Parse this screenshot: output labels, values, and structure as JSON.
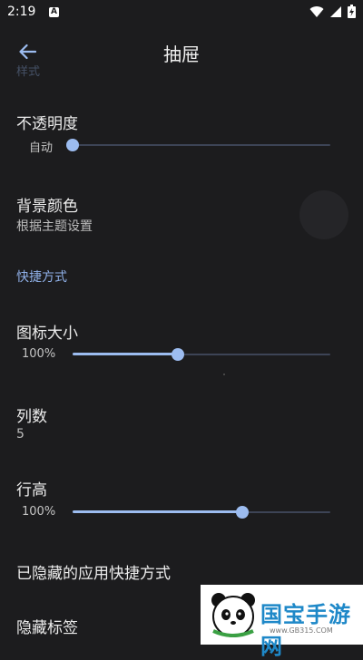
{
  "status_bar": {
    "time": "2:19",
    "notification_glyph": "A",
    "icons": [
      "wifi-icon",
      "signal-icon",
      "battery-icon"
    ]
  },
  "appbar": {
    "title": "抽屉",
    "back_icon": "arrow-left-icon",
    "ghost_label": "样式"
  },
  "settings": {
    "opacity": {
      "title": "不透明度",
      "value_label": "自动",
      "value": 0.0
    },
    "background_color": {
      "title": "背景颜色",
      "subtitle": "根据主题设置"
    },
    "shortcuts_section": "快捷方式",
    "icon_size": {
      "title": "图标大小",
      "value_label": "100%",
      "value": 0.41
    },
    "columns": {
      "title": "列数",
      "subtitle": "5"
    },
    "row_height": {
      "title": "行高",
      "value_label": "100%",
      "value": 0.66
    },
    "hidden_shortcuts": {
      "title": "已隐藏的应用快捷方式"
    },
    "hidden_labels": {
      "title": "隐藏标签"
    }
  },
  "watermark": {
    "text": "国宝手游网",
    "url": "www.GB315.COM"
  },
  "colors": {
    "accent": "#9cbcf0",
    "background": "#1c1c1e",
    "track": "#3d4456"
  }
}
